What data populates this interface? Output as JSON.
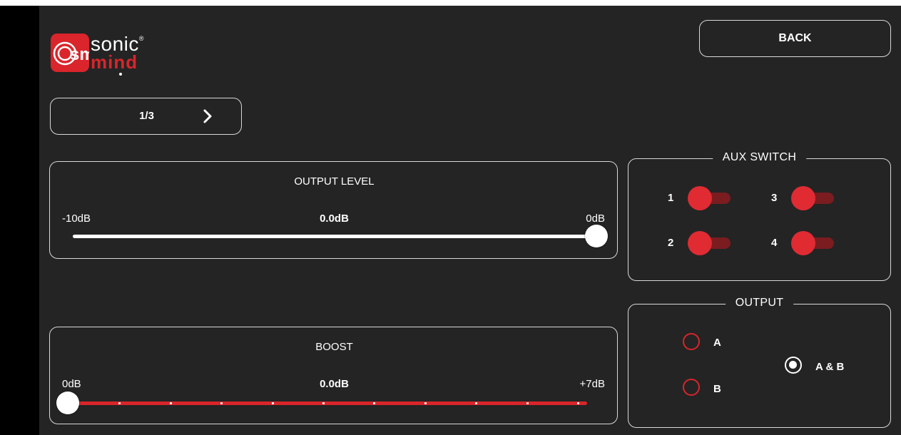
{
  "brand": {
    "logo_mark": "sm",
    "name_top": "sonic",
    "trademark": "®",
    "name_bottom": "mind"
  },
  "header": {
    "back_label": "BACK"
  },
  "pager": {
    "page_label": "1/3",
    "next_icon": "chevron-right-icon"
  },
  "output_level": {
    "title": "OUTPUT LEVEL",
    "min_label": "-10dB",
    "max_label": "0dB",
    "value_label": "0.0dB",
    "value_fraction": 1.0
  },
  "boost": {
    "title": "BOOST",
    "min_label": "0dB",
    "max_label": "+7dB",
    "value_label": "0.0dB",
    "value_fraction": 0.0
  },
  "aux_switch": {
    "title": "AUX SWITCH",
    "switches": [
      {
        "label": "1",
        "on": false
      },
      {
        "label": "2",
        "on": false
      },
      {
        "label": "3",
        "on": false
      },
      {
        "label": "4",
        "on": false
      }
    ]
  },
  "output": {
    "title": "OUTPUT",
    "options": [
      {
        "label": "A",
        "selected": false
      },
      {
        "label": "B",
        "selected": false
      },
      {
        "label": "A & B",
        "selected": true
      }
    ]
  },
  "colors": {
    "background": "#242424",
    "accent": "#d9252b",
    "border": "#d9d9d9"
  }
}
